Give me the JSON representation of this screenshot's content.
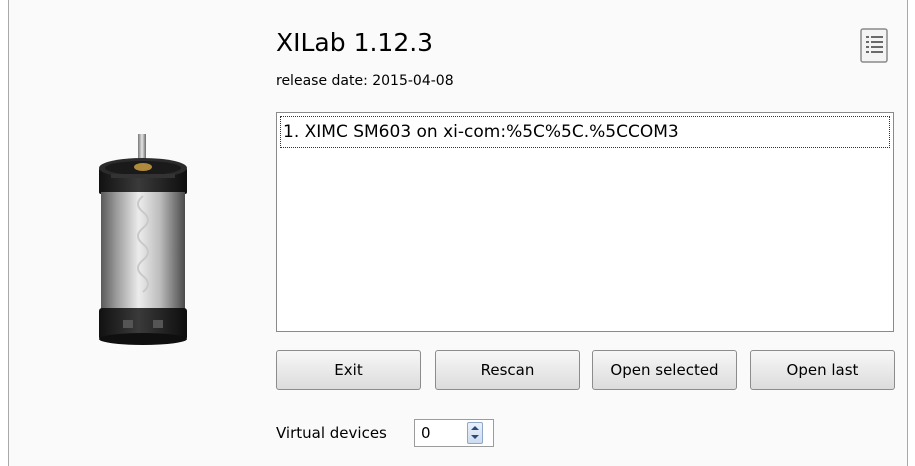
{
  "app": {
    "title": "XILab 1.12.3",
    "release_date": "release date: 2015-04-08"
  },
  "device_list": {
    "items": [
      {
        "label": "1. XIMC SM603 on xi-com:%5C%5C.%5CCOM3",
        "selected": true
      }
    ]
  },
  "buttons": {
    "exit": "Exit",
    "rescan": "Rescan",
    "open_selected": "Open selected",
    "open_last": "Open last"
  },
  "virtual_devices": {
    "label": "Virtual devices",
    "value": "0"
  },
  "icons": {
    "about": "document-list-icon",
    "motor": "stepper-motor-image"
  }
}
